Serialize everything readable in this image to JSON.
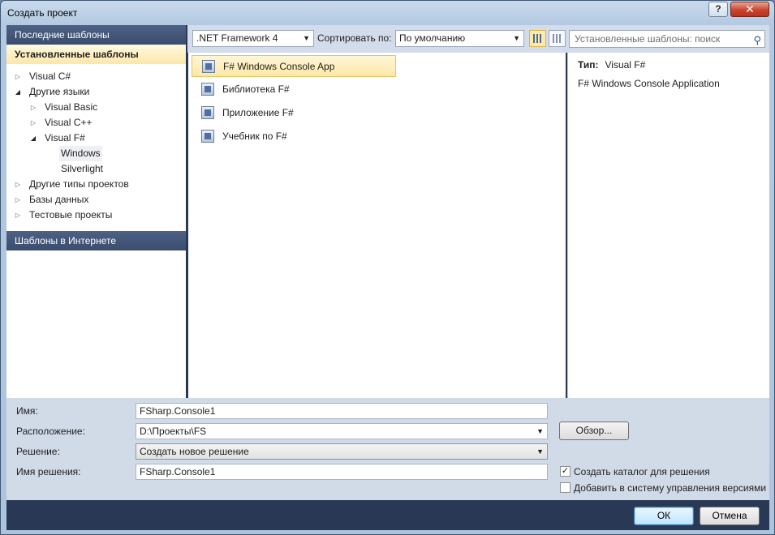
{
  "window": {
    "title": "Создать проект",
    "help_glyph": "?",
    "close_glyph": "✕"
  },
  "left_pane": {
    "recent_header": "Последние шаблоны",
    "installed_header": "Установленные шаблоны",
    "online_header": "Шаблоны в Интернете",
    "tree": [
      {
        "label": "Visual C#",
        "arrow": "▷"
      },
      {
        "label": "Другие языки",
        "arrow": "◢"
      },
      {
        "label": "Visual Basic",
        "arrow": "▷"
      },
      {
        "label": "Visual C++",
        "arrow": "▷"
      },
      {
        "label": "Visual F#",
        "arrow": "◢"
      },
      {
        "label": "Windows",
        "arrow": ""
      },
      {
        "label": "Silverlight",
        "arrow": ""
      },
      {
        "label": "Другие типы проектов",
        "arrow": "▷"
      },
      {
        "label": "Базы данных",
        "arrow": "▷"
      },
      {
        "label": "Тестовые проекты",
        "arrow": "▷"
      }
    ]
  },
  "toolbar": {
    "framework": ".NET Framework 4",
    "sort_label": "Сортировать по:",
    "sort_value": "По умолчанию",
    "search_placeholder": "Установленные шаблоны: поиск"
  },
  "templates": [
    {
      "label": "F# Windows Console App",
      "icon": "console-app-icon"
    },
    {
      "label": "Библиотека F#",
      "icon": "library-icon"
    },
    {
      "label": "Приложение F#",
      "icon": "application-icon"
    },
    {
      "label": "Учебник по F#",
      "icon": "tutorial-icon"
    }
  ],
  "info": {
    "type_label": "Тип:",
    "type_value": "Visual F#",
    "description": "F# Windows Console Application"
  },
  "form": {
    "name_label": "Имя:",
    "name_value": "FSharp.Console1",
    "location_label": "Расположение:",
    "location_value": "D:\\Проекты\\FS",
    "solution_label": "Решение:",
    "solution_value": "Создать новое решение",
    "solution_name_label": "Имя решения:",
    "solution_name_value": "FSharp.Console1",
    "browse_label": "Обзор...",
    "create_dir_label": "Создать каталог для решения",
    "create_dir_checked": true,
    "add_vcs_label": "Добавить в систему управления версиями",
    "add_vcs_checked": false
  },
  "footer": {
    "ok_label": "ОК",
    "cancel_label": "Отмена"
  }
}
